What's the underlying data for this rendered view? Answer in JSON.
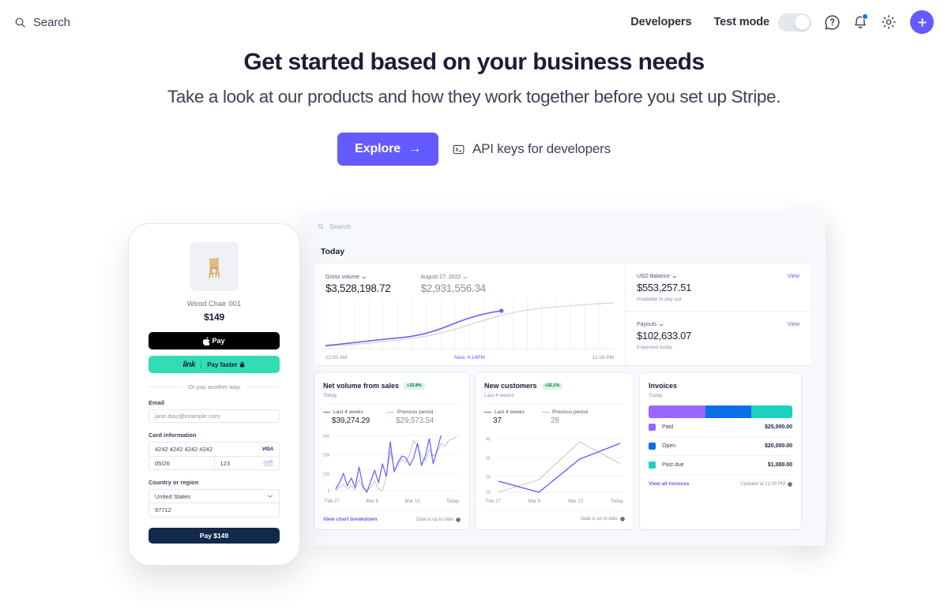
{
  "topnav": {
    "search_label": "Search",
    "developers_label": "Developers",
    "test_mode_label": "Test mode",
    "test_mode_on": false,
    "help_icon": "question-circle-icon",
    "notifications_icon": "bell-icon",
    "settings_icon": "gear-icon",
    "add_icon": "plus-icon"
  },
  "hero": {
    "title": "Get started based on your business needs",
    "subtitle": "Take a look at our products and how they work together before you set up Stripe.",
    "explore_button": "Explore",
    "explore_arrow": "→",
    "api_link": "API keys for developers",
    "api_link_icon": "terminal-icon",
    "accent_color": "#635bff"
  },
  "phone": {
    "product_name": "Wood Chair 001",
    "product_price": "$149",
    "apple_pay_label": "Pay",
    "link_brand": "link",
    "link_tagline": "Pay faster",
    "link_lock_icon": "lock-icon",
    "divider_label": "Or pay another way",
    "email_label": "Email",
    "email_placeholder": "jane.diaz@example.com",
    "card_label": "Card information",
    "card_number": "4242 4242 4242 4242",
    "card_brand": "VISA",
    "card_expiry": "05/26",
    "card_cvc": "123",
    "cvc_icon": "card-back-icon",
    "country_label": "Country or region",
    "country_value": "United States",
    "country_chevron_icon": "chevron-down-icon",
    "postal_value": "97712",
    "pay_button": "Pay $149",
    "link_color": "#33ddb3",
    "pay_button_color": "#11294b"
  },
  "dashboard": {
    "search_label": "Search",
    "section_title": "Today",
    "gross_volume": {
      "label": "Gross volume",
      "value": "$3,528,198.72",
      "compare_label": "August 27, 2022",
      "compare_value": "$2,931,556.34",
      "axis_start": "12:00 AM",
      "axis_now": "Now, 4:14PM",
      "axis_end": "11:59 PM"
    },
    "balance": {
      "label": "USD Balance",
      "value": "$553,257.51",
      "sub": "Available to pay out",
      "view_label": "View"
    },
    "payouts": {
      "label": "Payouts",
      "value": "$102,633.07",
      "sub": "Expected today",
      "view_label": "View"
    },
    "net_volume": {
      "title": "Net volume from sales",
      "badge": "+32.8%",
      "subtitle": "Today",
      "legend_current": "Last 4 weeks",
      "legend_previous": "Previous period",
      "value_current": "$39,274.29",
      "value_previous": "$29,573.54",
      "footer_link": "View chart breakdown",
      "footer_status": "Data is up to date",
      "footer_status_icon": "info-icon"
    },
    "new_customers": {
      "title": "New customers",
      "badge": "+32.1%",
      "subtitle": "Last 4 weeks",
      "legend_current": "Last 4 weeks",
      "legend_previous": "Previous period",
      "value_current": "37",
      "value_previous": "28",
      "footer_status": "Data is up to date",
      "footer_status_icon": "info-icon"
    },
    "invoices": {
      "title": "Invoices",
      "subtitle": "Today",
      "rows": [
        {
          "name": "Paid",
          "value": "$25,000.00",
          "color": "#9966ff"
        },
        {
          "name": "Open",
          "value": "$20,000.00",
          "color": "#0a6fe8"
        },
        {
          "name": "Past due",
          "value": "$1,000.00",
          "color": "#19d3be"
        }
      ],
      "footer_link": "View all invoices",
      "footer_status": "Updated at 12:00 PM",
      "footer_status_icon": "clock-icon"
    },
    "rail_icons": [
      {
        "name": "terminal-app-icon",
        "color": "#1a2a42"
      },
      {
        "name": "radar-app-icon",
        "color": "#2bbdf7"
      },
      {
        "name": "billing-app-icon",
        "color": "#ffd43b"
      },
      {
        "name": "connect-app-icon",
        "color": "#e6f542"
      },
      {
        "name": "climate-app-icon",
        "color": "#cfd8ea"
      },
      {
        "name": "issuing-app-icon",
        "color": "#fa3a5c"
      }
    ],
    "rail_add_icon": "plus-icon"
  },
  "chart_data": [
    {
      "type": "line",
      "title": "Gross volume",
      "id": "gross-volume",
      "xlabel": "",
      "ylabel": "",
      "grid": true,
      "x_ticks": [
        "12:00 AM",
        "Now, 4:14PM",
        "11:59 PM"
      ],
      "series": [
        {
          "name": "Today",
          "color": "#635bff",
          "values": [
            2,
            5,
            8,
            11,
            14,
            17,
            19,
            22,
            26,
            33,
            41,
            48,
            55,
            60
          ]
        },
        {
          "name": "August 27, 2022",
          "color": "#c9cde0",
          "values": [
            2,
            5,
            8,
            11,
            14,
            17,
            20,
            24,
            30,
            38,
            46,
            54,
            62,
            70,
            76,
            80,
            83,
            86,
            88,
            90
          ]
        }
      ]
    },
    {
      "type": "line",
      "title": "Net volume from sales",
      "id": "net-volume",
      "ylim": [
        0,
        50000
      ],
      "y_ticks": [
        "50k",
        "25k",
        "12k",
        "0"
      ],
      "x_ticks": [
        "Feb 27",
        "Mar 6",
        "Mar 13",
        "Today"
      ],
      "series": [
        {
          "name": "Last 4 weeks",
          "color": "#635bff",
          "total": "$39,274.29",
          "values": [
            2,
            10,
            20,
            6,
            14,
            4,
            22,
            6,
            0,
            10,
            18,
            8,
            24,
            14,
            42,
            18,
            26,
            30,
            28,
            22,
            28,
            40,
            22,
            30,
            44,
            24,
            34,
            48
          ]
        },
        {
          "name": "Previous period",
          "color": "#b7bfcb",
          "total": "$29,573.54",
          "values": [
            0,
            4,
            8,
            2,
            6,
            1,
            12,
            2,
            0,
            4,
            10,
            2,
            0,
            14,
            36,
            20,
            22,
            26,
            24,
            30,
            44,
            38,
            30,
            26,
            36,
            30,
            34,
            42
          ]
        }
      ]
    },
    {
      "type": "line",
      "title": "New customers",
      "id": "new-customers",
      "ylim": [
        10,
        40
      ],
      "y_ticks": [
        "40",
        "30",
        "20",
        "10"
      ],
      "x_ticks": [
        "Feb 27",
        "Mar 6",
        "Mar 13",
        "Today"
      ],
      "series": [
        {
          "name": "Last 4 weeks",
          "color": "#635bff",
          "total": "37",
          "values": [
            18,
            10,
            28,
            37
          ]
        },
        {
          "name": "Previous period",
          "color": "#b7bfcb",
          "total": "28",
          "values": [
            10,
            18,
            37,
            28
          ]
        }
      ]
    },
    {
      "type": "bar",
      "title": "Invoices",
      "id": "invoices-stack",
      "stacked": true,
      "categories": [
        "Paid",
        "Open",
        "Past due"
      ],
      "values": [
        25000,
        20000,
        1000
      ],
      "display_values": [
        "$25,000.00",
        "$20,000.00",
        "$1,000.00"
      ],
      "colors": [
        "#9966ff",
        "#0a6fe8",
        "#19d3be"
      ]
    }
  ]
}
